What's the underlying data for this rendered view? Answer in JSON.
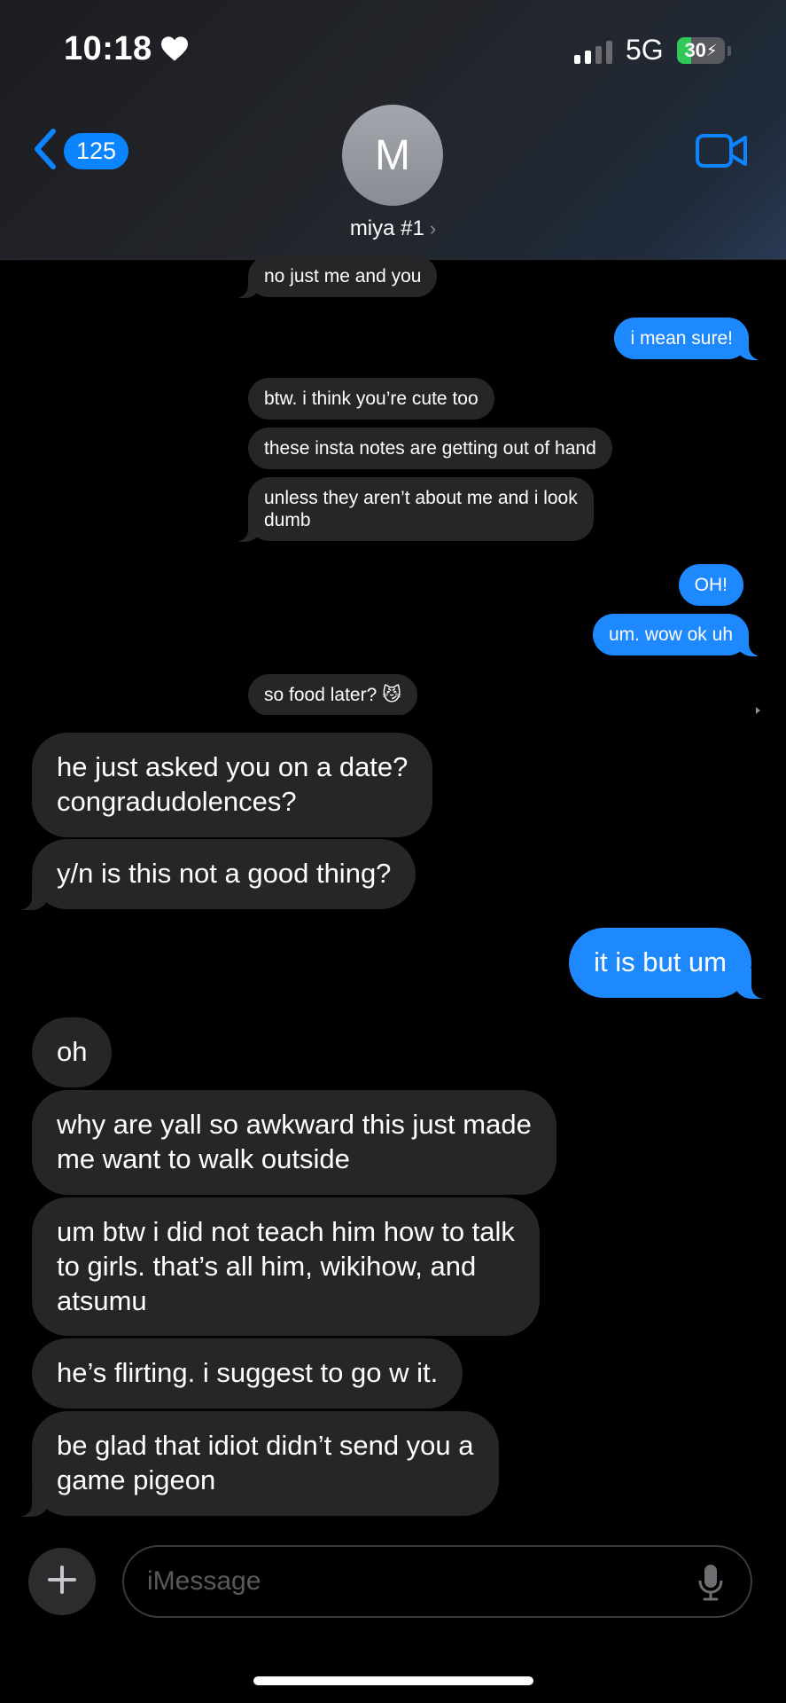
{
  "status_bar": {
    "time": "10:18",
    "network": "5G",
    "battery_level": "30",
    "battery_fraction": 0.3,
    "signal_bars_active": 2,
    "signal_bars_total": 4
  },
  "header": {
    "back_count": "125",
    "avatar_initial": "M",
    "contact_name": "miya #1",
    "accent_color": "#0a84ff"
  },
  "messages": [
    {
      "side": "in",
      "size": "small",
      "text": "no just me and you"
    },
    {
      "side": "out",
      "size": "small",
      "text": "i mean sure!"
    },
    {
      "side": "in",
      "size": "small",
      "text": "btw. i think you’re cute too"
    },
    {
      "side": "in",
      "size": "small",
      "text": "these insta notes are getting out of hand"
    },
    {
      "side": "in",
      "size": "small",
      "lines": [
        "unless they aren’t about me and i look",
        "dumb"
      ]
    },
    {
      "side": "out",
      "size": "small",
      "text": "OH!"
    },
    {
      "side": "out",
      "size": "small",
      "text": "um. wow ok uh"
    },
    {
      "side": "in",
      "size": "small",
      "text": "so food later? 😼"
    },
    {
      "side": "in",
      "size": "large",
      "lines": [
        "he just asked you on a date?",
        "congradudolences?"
      ]
    },
    {
      "side": "in",
      "size": "large",
      "text": "y/n is this not a good thing?"
    },
    {
      "side": "out",
      "size": "large",
      "text": "it is but um"
    },
    {
      "side": "in",
      "size": "large",
      "text": "oh"
    },
    {
      "side": "in",
      "size": "large",
      "lines": [
        "why are yall so awkward this just made",
        "me want to walk outside"
      ]
    },
    {
      "side": "in",
      "size": "large",
      "lines": [
        "um btw i did not teach him how to talk",
        "to girls. that’s all him, wikihow, and",
        "atsumu"
      ]
    },
    {
      "side": "in",
      "size": "large",
      "text": "he’s flirting. i suggest to go w it."
    },
    {
      "side": "in",
      "size": "large",
      "lines": [
        "be glad that idiot didn’t send you a",
        "game pigeon"
      ]
    }
  ],
  "composer": {
    "placeholder": "iMessage"
  },
  "icons": [
    "heart-icon",
    "signal-icon",
    "battery-icon",
    "back-chevron-icon",
    "video-camera-icon",
    "chevron-right-icon",
    "plus-icon",
    "microphone-icon"
  ]
}
